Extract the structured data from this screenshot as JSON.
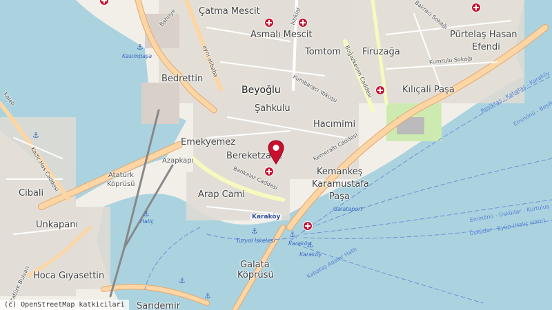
{
  "map": {
    "attribution": "(c) OpenStreetMap katkicilari",
    "colors": {
      "water": "#aad3df",
      "land": "#f2efe9",
      "primary_road": "#fcd6a4",
      "secondary_road": "#f7fabf",
      "motorway": "#e892a2",
      "marker": "#c8102e"
    },
    "places": [
      {
        "id": "catma",
        "text": "Çatma Mescit"
      },
      {
        "id": "asmali",
        "text": "Asmalı Mescit"
      },
      {
        "id": "tomtom",
        "text": "Tomtom"
      },
      {
        "id": "firuzaga",
        "text": "Firuzağa"
      },
      {
        "id": "purtelas",
        "text": "Pürtelaş Hasan"
      },
      {
        "id": "efendi",
        "text": "Efendi"
      },
      {
        "id": "bedrettin",
        "text": "Bedrettin"
      },
      {
        "id": "beyoglu",
        "text": "Beyoğlu"
      },
      {
        "id": "sahkulu",
        "text": "Şahkulu"
      },
      {
        "id": "kilicali",
        "text": "Kılıçali Paşa"
      },
      {
        "id": "hacimimi",
        "text": "Hacımimi"
      },
      {
        "id": "emekyemez",
        "text": "Emekyemez"
      },
      {
        "id": "bereketzade",
        "text": "Bereketzade"
      },
      {
        "id": "kemankes",
        "text": "Kemankeş"
      },
      {
        "id": "karamustafa",
        "text": "Karamustafa"
      },
      {
        "id": "pasa",
        "text": "Paşa"
      },
      {
        "id": "cibali",
        "text": "Cibali"
      },
      {
        "id": "arapcami",
        "text": "Arap Cami"
      },
      {
        "id": "unkapani",
        "text": "Unkapanı"
      },
      {
        "id": "hocagiyasettin",
        "text": "Hoca Gıyasettin"
      },
      {
        "id": "saridemir",
        "text": "Sarıdemir"
      },
      {
        "id": "galata",
        "text": "Galata"
      },
      {
        "id": "koprusu",
        "text": "Köprüsü"
      }
    ],
    "streets": [
      {
        "id": "bahriye",
        "text": "Bahriye"
      },
      {
        "id": "ayni",
        "text": "aynı alibaba"
      },
      {
        "id": "kumbaraci",
        "text": "Kumbaracı Yokuşu"
      },
      {
        "id": "bogazkesen",
        "text": "Boğazkesen Caddesi"
      },
      {
        "id": "bakraci",
        "text": "Bakracı Sokağı"
      },
      {
        "id": "kumrulu",
        "text": "Kumrulu Sokağı"
      },
      {
        "id": "kemeralti",
        "text": "Kemeraltı Caddesi"
      },
      {
        "id": "bankalar",
        "text": "Bankalar Caddesi"
      },
      {
        "id": "istiklal",
        "text": "İstiklal"
      },
      {
        "id": "kadirhas",
        "text": "Kadir Has Caddesi"
      },
      {
        "id": "ataturk1",
        "text": "Atatürk"
      },
      {
        "id": "ataturk2",
        "text": "Köprüsü"
      },
      {
        "id": "azapkapi",
        "text": "Azapkapı"
      },
      {
        "id": "kbulvari",
        "text": "Atatürk Bulvarı"
      },
      {
        "id": "kaleli",
        "text": "Kaleli"
      }
    ],
    "water_labels": [
      {
        "id": "kasimpasa",
        "text": "Kasımpaşa"
      },
      {
        "id": "halic",
        "text": "Haliç"
      },
      {
        "id": "galataport",
        "text": "Galataport"
      },
      {
        "id": "turyol",
        "text": "Turyol İskelesi"
      },
      {
        "id": "karakoy1",
        "text": "Karaköy"
      },
      {
        "id": "karakoy2",
        "text": "Karaköy"
      }
    ],
    "ferry_labels": [
      {
        "id": "f1",
        "text": "Beşiktaş - Kabataş - Karaköy"
      },
      {
        "id": "f2",
        "text": "Eminönü - Beşiktaş"
      },
      {
        "id": "f3",
        "text": "Eminönü - Üsküdar - Kurtuluş"
      },
      {
        "id": "f4",
        "text": "Üsküdar - Eyüp (Haliç Hattı)"
      },
      {
        "id": "f5",
        "text": "Kabataş Adalar Hattı"
      }
    ],
    "transit_stop": {
      "text": "Karaköy"
    },
    "marker": {
      "label": "Selected location"
    }
  }
}
